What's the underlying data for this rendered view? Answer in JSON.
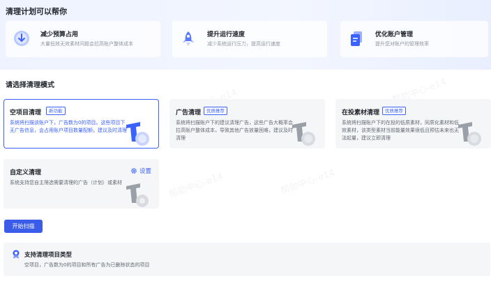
{
  "header": {
    "title": "清理计划可以帮你"
  },
  "benefits": [
    {
      "title": "减少预算占用",
      "desc": "大量低效无效素材问题会拉高账户整体成本",
      "icon": "download-arrow-icon"
    },
    {
      "title": "提升运行速度",
      "desc": "减少系统运行压力，提高运行速度",
      "icon": "rocket-icon"
    },
    {
      "title": "优化账户管理",
      "desc": "提升您对账户的管理效率",
      "icon": "document-icon"
    }
  ],
  "mode_section": {
    "title": "请选择清理模式"
  },
  "modes": [
    {
      "title": "空项目清理",
      "tag": "新功能",
      "desc": "系统将扫描该账户下，广告数为0的项目。这些项目下无广告信息，会占用账户项目数量配额，建议及时清理"
    },
    {
      "title": "广告清理",
      "tag": "优质推荐",
      "desc": "系统将扫描账户下的建议清理广告，这些广告大概率会拉高账户整体成本，导致其他广告放量困难，建议及时清理"
    },
    {
      "title": "在投素材清理",
      "tag": "优质推荐",
      "desc": "系统将扫描账户下的在投的低质素材，同质化素材和低效素材，该类型素材当前能量效果很低且预估未来也无法起量，建议立即清理"
    },
    {
      "title": "自定义清理",
      "settings_label": "设置",
      "desc": "系统支持您自主筛选需要清理的广告（计划）或素材"
    }
  ],
  "actions": {
    "start_label": "开始扫描"
  },
  "support": {
    "title": "支持清理项目类型",
    "desc": "空项目，广告数为0的项目和所有广告为已删除状态的项目"
  },
  "watermark": "帮助中心-e14",
  "colors": {
    "primary": "#3b62ff",
    "button": "#3b5ce8",
    "card_bg": "#f5f6f7",
    "hero_bg": "#eef3ff"
  }
}
